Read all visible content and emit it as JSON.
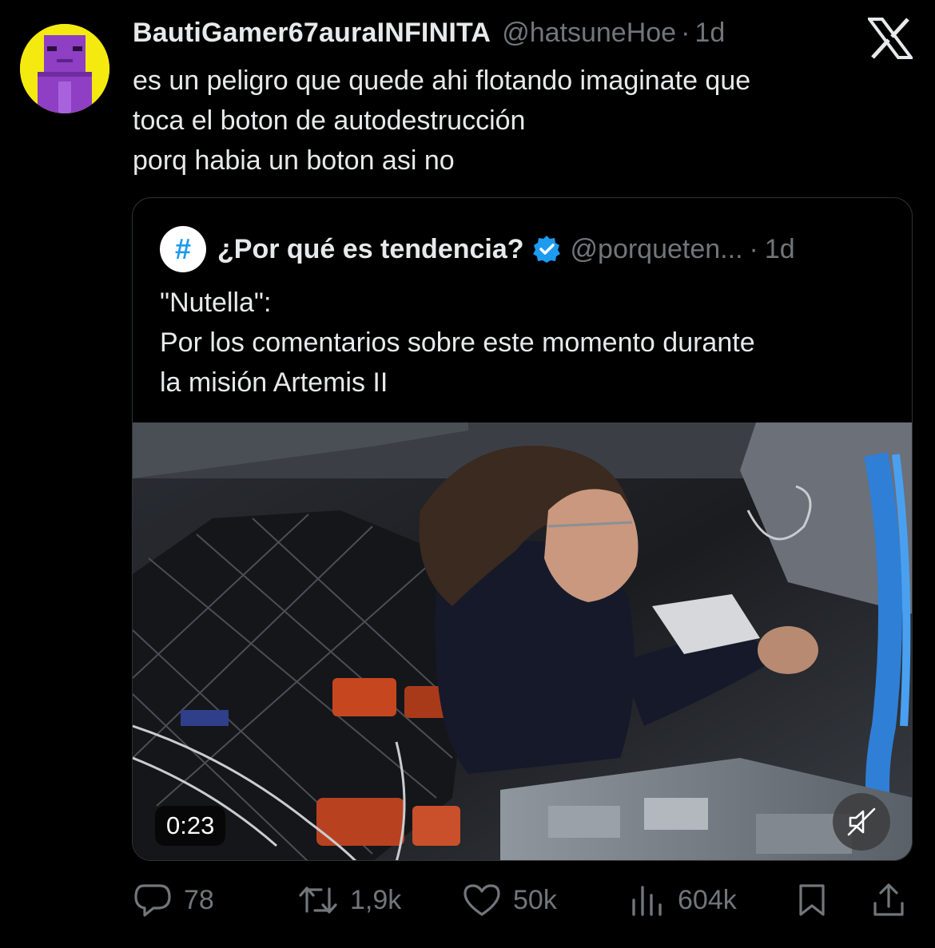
{
  "tweet": {
    "display_name": "BautiGamer67auraINFINITA",
    "handle": "@hatsuneHoe",
    "separator": "·",
    "time": "1d",
    "lines": [
      "es un peligro que quede ahi flotando imaginate que",
      "toca el boton de autodestrucción",
      "porq habia un boton asi no"
    ]
  },
  "quote": {
    "avatar_symbol": "#",
    "display_name": "¿Por qué es tendencia?",
    "verified": true,
    "handle": "@porqueten...",
    "separator": "·",
    "time": "1d",
    "lines": [
      "\"Nutella\":",
      "Por los comentarios sobre este momento durante",
      "la misión Artemis II"
    ],
    "video": {
      "duration": "0:23"
    }
  },
  "actions": {
    "replies": "78",
    "reposts": "1,9k",
    "likes": "50k",
    "views": "604k"
  },
  "colors": {
    "background": "#000000",
    "text": "#e7e9ea",
    "muted": "#71767b",
    "border": "#2f3336",
    "verified": "#1d9bf0",
    "avatar_bg": "#f4ea10",
    "avatar_figure": "#8e3fc4"
  },
  "icons": {
    "brand": "x-logo-icon",
    "reply": "reply-icon",
    "repost": "repost-icon",
    "like": "heart-icon",
    "views": "views-icon",
    "bookmark": "bookmark-icon",
    "share": "share-icon",
    "mute": "muted-speaker-icon"
  }
}
